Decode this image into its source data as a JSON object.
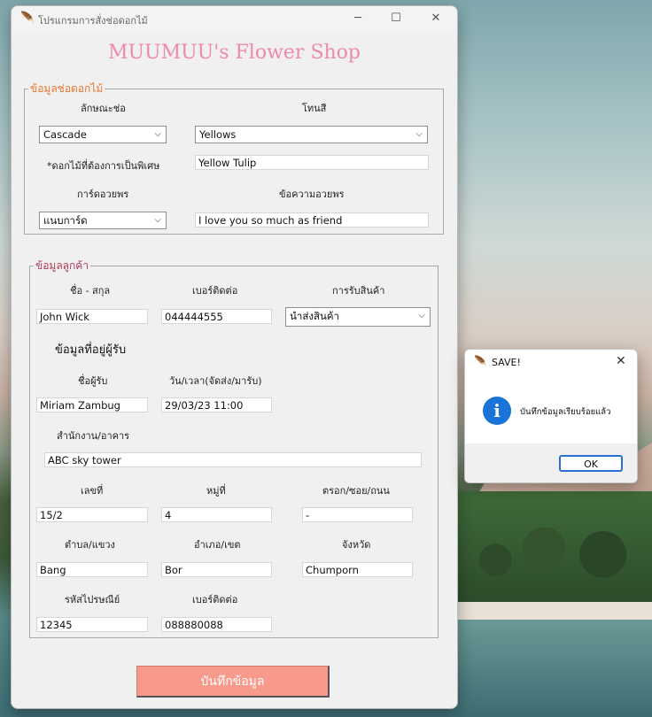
{
  "window": {
    "title": "โปรแกรมการสั่งช่อดอกไม้",
    "app_icon": "feather-icon",
    "minimize": "─",
    "maximize": "☐",
    "close": "✕"
  },
  "heading": "MUUMUU's Flower Shop",
  "bouquet": {
    "legend": "ข้อมูลช่อดอกไม้",
    "legend_color": "#e8772e",
    "style_label": "ลักษณะช่อ",
    "style_value": "Cascade",
    "tone_label": "โทนสี",
    "tone_value": "Yellows",
    "special_label": "*ดอกไม้ที่ต้องการเป็นพิเศษ",
    "special_value": "Yellow Tulip",
    "card_label": "การ์ดอวยพร",
    "card_value": "แนบการ์ด",
    "message_label": "ข้อความอวยพร",
    "message_value": "I love you so much as friend"
  },
  "customer": {
    "legend": "ข้อมูลลูกค้า",
    "legend_color": "#b03a5b",
    "name_label": "ชื่อ - สกุล",
    "name_value": "John Wick",
    "phone_label": "เบอร์ติดต่อ",
    "phone_value": "044444555",
    "receive_label": "การรับสินค้า",
    "receive_value": "นำส่งสินค้า",
    "recipient_heading": "ข้อมูลที่อยู่ผู้รับ",
    "recipient_name_label": "ชื่อผู้รับ",
    "recipient_name_value": "Miriam Zambug",
    "datetime_label": "วัน/เวลา(จัดส่ง/มารับ)",
    "datetime_value": "29/03/23 11:00",
    "office_label": "สำนักงาน/อาคาร",
    "office_value": "ABC sky tower",
    "number_label": "เลขที่",
    "number_value": "15/2",
    "moo_label": "หมู่ที่",
    "moo_value": "4",
    "alley_label": "ตรอก/ซอย/ถนน",
    "alley_value": "-",
    "subdistrict_label": "ตำบล/แขวง",
    "subdistrict_value": "Bang",
    "district_label": "อำเภอ/เขต",
    "district_value": "Bor",
    "province_label": "จังหวัด",
    "province_value": "Chumporn",
    "postcode_label": "รหัสไปรษณีย์",
    "postcode_value": "12345",
    "phone2_label": "เบอร์ติดต่อ",
    "phone2_value": "088880088"
  },
  "save_button": "บันทึกข้อมูล",
  "save_button_color": "#f79a8c",
  "dialog": {
    "title": "SAVE!",
    "icon": "info-icon",
    "icon_glyph": "i",
    "message": "บันทึกข้อมูลเรียบร้อยแล้ว",
    "ok": "OK",
    "close": "✕"
  }
}
